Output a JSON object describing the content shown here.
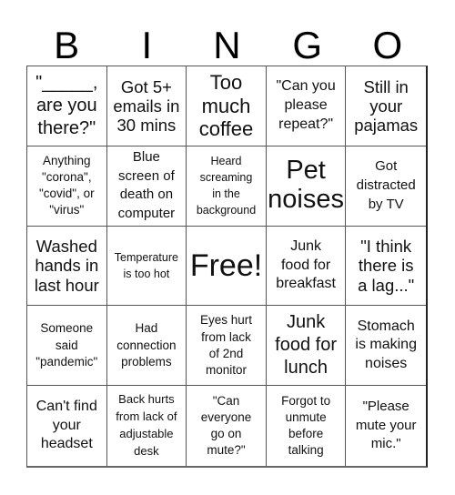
{
  "title_letters": [
    "B",
    "I",
    "N",
    "G",
    "O"
  ],
  "cells": [
    "\"_____,\nare you\nthere?\"",
    "Got 5+\nemails in\n30 mins",
    "Too\nmuch\ncoffee",
    "\"Can you\nplease\nrepeat?\"",
    "Still in\nyour\npajamas",
    "Anything\n\"corona\",\n\"covid\", or\n\"virus\"",
    "Blue\nscreen of\ndeath on\ncomputer",
    "Heard\nscreaming\nin the\nbackground",
    "Pet\nnoises",
    "Got\ndistracted\nby TV",
    "Washed\nhands in\nlast hour",
    "Temperature\nis too hot",
    "Free!",
    "Junk\nfood for\nbreakfast",
    "\"I think\nthere is\na lag...\"",
    "Someone\nsaid\n\"pandemic\"",
    "Had\nconnection\nproblems",
    "Eyes hurt\nfrom lack\nof 2nd\nmonitor",
    "Junk\nfood for\nlunch",
    "Stomach\nis making\nnoises",
    "Can't find\nyour\nheadset",
    "Back hurts\nfrom lack of\nadjustable\ndesk",
    "\"Can\neveryone\ngo on\nmute?\"",
    "Forgot to\nunmute\nbefore\ntalking",
    "\"Please\nmute your\nmic.\""
  ]
}
